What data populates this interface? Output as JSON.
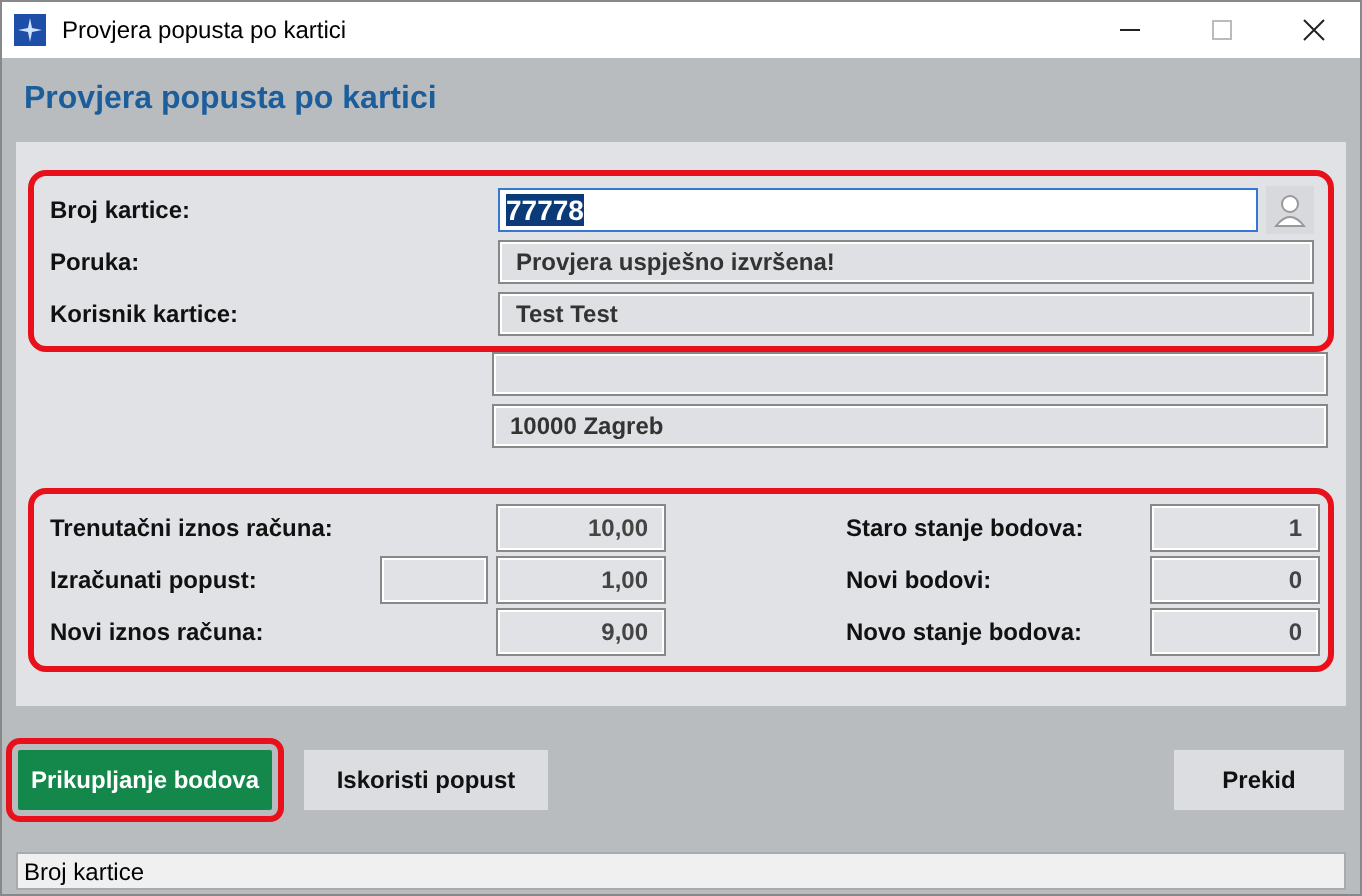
{
  "window": {
    "title": "Provjera popusta po kartici"
  },
  "heading": "Provjera popusta po kartici",
  "card_section": {
    "highlighted": true,
    "fields": [
      {
        "label": "Broj kartice:",
        "kind": "input",
        "value": "77778",
        "text_selected": true
      },
      {
        "label": "Poruka:",
        "kind": "readonly",
        "value": "Provjera uspješno izvršena!"
      },
      {
        "label": "Korisnik kartice:",
        "kind": "readonly",
        "value": "Test Test"
      }
    ]
  },
  "address_fields": [
    {
      "kind": "readonly"
    },
    {
      "kind": "readonly",
      "value": "10000 Zagreb"
    }
  ],
  "amounts_section": {
    "highlighted": true,
    "left": [
      {
        "label": "Trenutačni iznos računa:",
        "value": "10,00",
        "extra_box": false
      },
      {
        "label": "Izračunati popust:",
        "value": "1,00",
        "extra_box": true
      },
      {
        "label": "Novi iznos računa:",
        "value": "9,00",
        "extra_box": false
      }
    ],
    "right": [
      {
        "label": "Staro stanje bodova:",
        "value": "1"
      },
      {
        "label": "Novi bodovi:",
        "value": "0"
      },
      {
        "label": "Novo stanje bodova:",
        "value": "0"
      }
    ]
  },
  "buttons": [
    {
      "label": "Prikupljanje bodova",
      "kind": "primary",
      "highlighted": true
    },
    {
      "label": "Iskoristi popust",
      "kind": "normal",
      "highlighted": false
    },
    {
      "label": "Prekid",
      "kind": "cancel",
      "highlighted": false
    }
  ],
  "status_bar": "Broj kartice"
}
